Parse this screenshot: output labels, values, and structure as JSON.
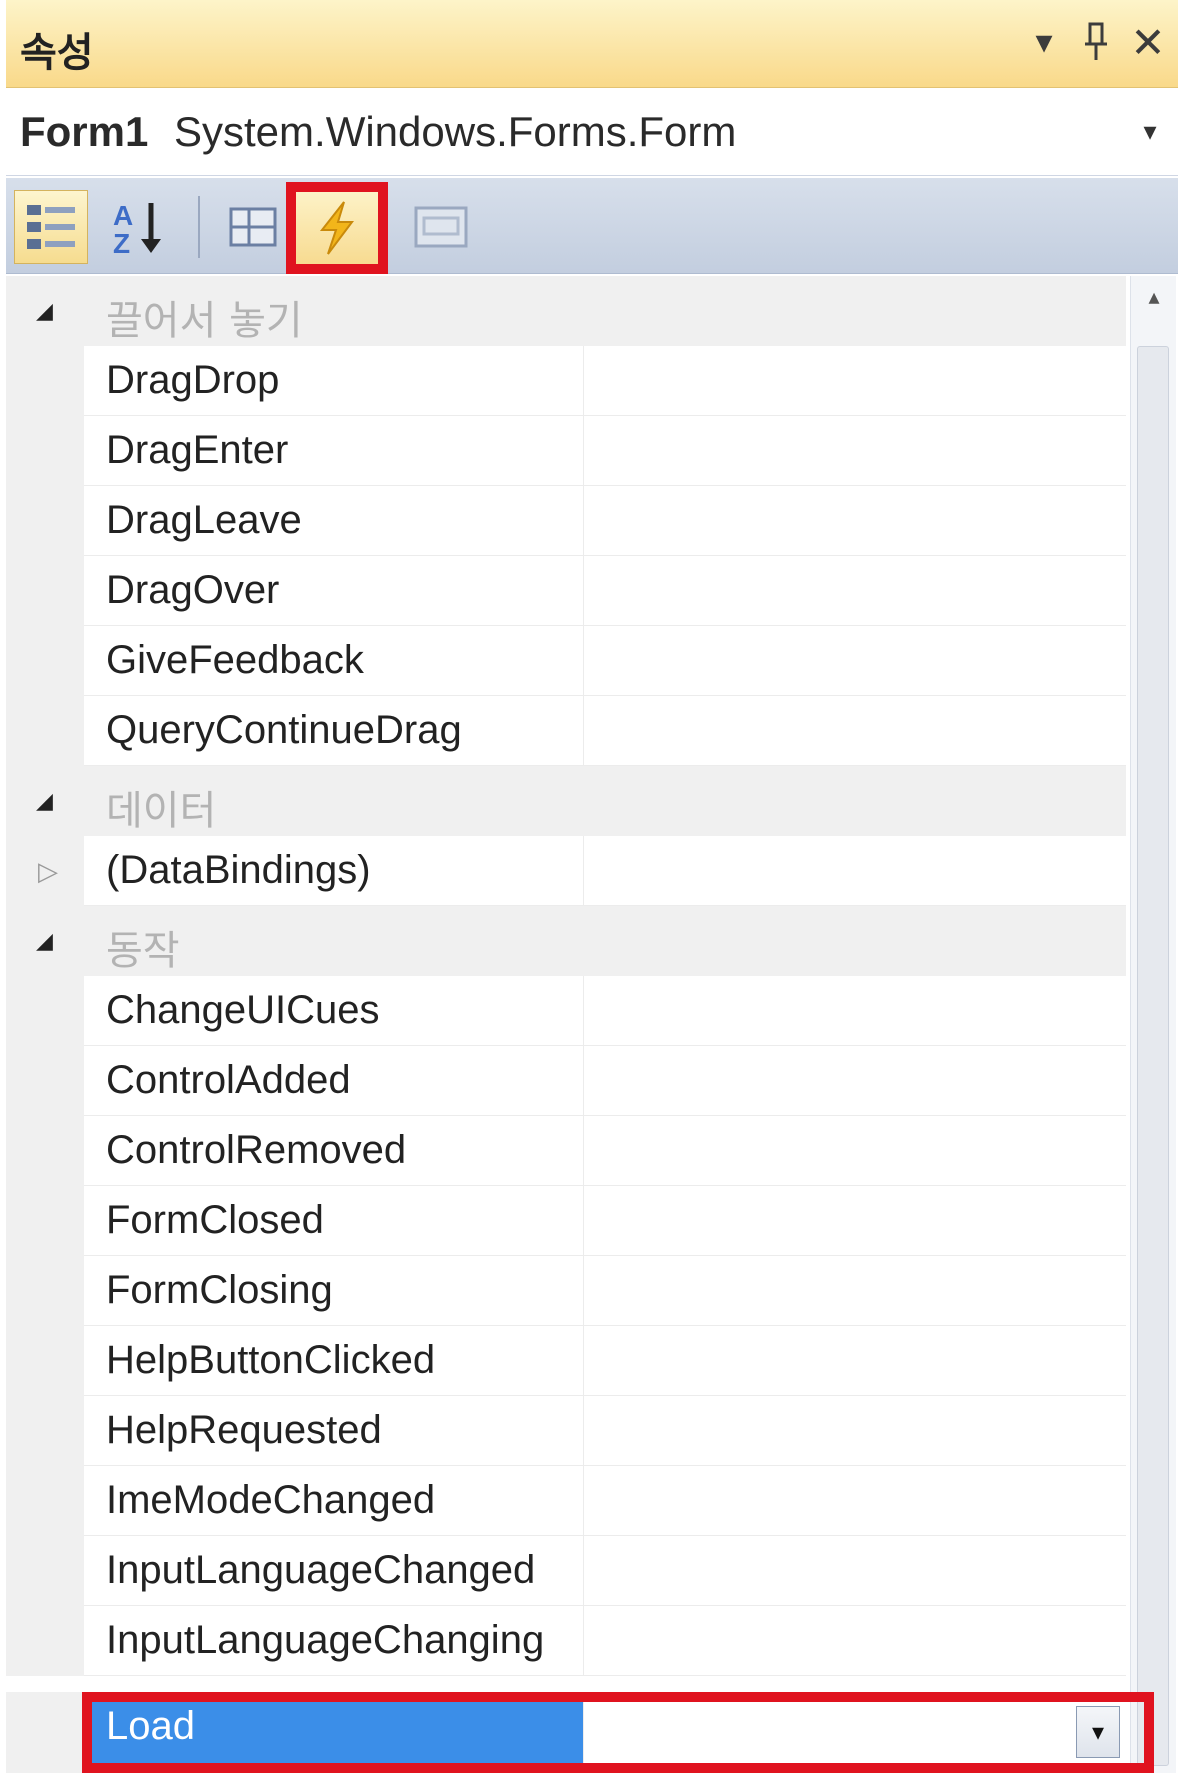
{
  "window": {
    "title": "속성",
    "dropdown_icon": "▾",
    "pin_icon": "⊥",
    "close_icon": "✕"
  },
  "selector": {
    "name": "Form1",
    "type": "System.Windows.Forms.Form",
    "arrow": "▾"
  },
  "toolbar": {
    "categorized_icon": "categorized-icon",
    "alphabetical_icon": "sort-az-icon",
    "properties_icon": "properties-icon",
    "events_icon": "lightning-icon",
    "property_pages_icon": "property-pages-icon",
    "active": "events"
  },
  "grid": {
    "categories": {
      "dragdrop": "끌어서 놓기",
      "data": "데이터",
      "behavior": "동작"
    },
    "events": {
      "e0": "DragDrop",
      "e1": "DragEnter",
      "e2": "DragLeave",
      "e3": "DragOver",
      "e4": "GiveFeedback",
      "e5": "QueryContinueDrag",
      "databindings": "(DataBindings)",
      "e6": "ChangeUICues",
      "e7": "ControlAdded",
      "e8": "ControlRemoved",
      "e9": "FormClosed",
      "e10": "FormClosing",
      "e11": "HelpButtonClicked",
      "e12": "HelpRequested",
      "e13": "ImeModeChanged",
      "e14": "InputLanguageChanged",
      "e15": "InputLanguageChanging",
      "load": "Load"
    },
    "load_value": "",
    "load_dropdown": "▾",
    "expanded_glyph": "◢",
    "collapsed_glyph": "▷"
  },
  "scrollbar": {
    "up": "▴"
  },
  "colors": {
    "highlight_red": "#e0131f",
    "selection_blue": "#3b8ee8",
    "titlebar_gold": "#f9d98a"
  }
}
